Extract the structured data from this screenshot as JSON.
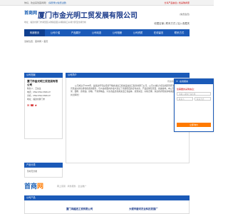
{
  "topbar": {
    "welcome": "你好，欢迎来到首商网！",
    "login": "[请登录]",
    "register": "[免费注册]",
    "right": "分享产品信息 | 找采购商家"
  },
  "header": {
    "logo": "首商网",
    "company": "厦门市金光明工贸发展有限公司",
    "address": "地址：福建省厦门市湖里区兴隆路园区兴湖路路口兴湖大厦宝龙湖景城",
    "member": "[免费会员]",
    "links": "收藏店铺 | 联系方式 | 加入收藏夹"
  },
  "nav": {
    "items": [
      "商铺首页",
      "公司介绍",
      "产品展厅",
      "公司动态",
      "公司相册",
      "公司资质",
      "在线留言",
      "联系方式"
    ]
  },
  "breadcrumb": "当前位置：首商网 > 首页",
  "sidebar": {
    "contact_head": "公司档案",
    "company": "厦门市金光明工贸发展有限公司",
    "contact_person": "联系人：王先生",
    "phone": "电话：0592-5532-5595-97",
    "mobile": "手机：0592-5532-5595-97",
    "address": "地址：福建省厦门市",
    "icons": "✉ ☎ ★",
    "category_head": "产品分类",
    "category_item": "暂时无分类"
  },
  "intro": {
    "head": "公司简介",
    "sub": "所属地区:福建厦门市",
    "text": "公司成立于1994年，是集多年专业经营干粮食进出口和食品进出口贸易的厦门公司，公司以诚信为宗旨和原则开发项目品牌。凭借良好的信誉和优质的服务，与众多的国内外客户建立了长期稳定的合作关系，产品远销东南亚、欧美等地。本公司主营各类大米、面粉、食用油、杂粮、干货调味品、冷冻食品及各类进出口食品等，货源充足，价格合理，欢迎各界朋友来电来函洽谈业务，共创辉煌！"
  },
  "banner": {
    "brand_a": "首商",
    "brand_b": "网",
    "tags": "网上贸易 · 商务服务 · 企业推广"
  },
  "bottom": {
    "head": "公司产品",
    "item1": "厦门鸿越洁工贸有限公司",
    "item2": "大理市碧河农业科技发展厂"
  },
  "float_panel": {
    "title": "在线留言",
    "close": "✕",
    "label": "您需要的采购信息：",
    "placeholder1": "请输入采购产品名称",
    "placeholder2": "联系人",
    "placeholder3": "联系方式",
    "submit": "立即询价"
  },
  "colors": {
    "primary": "#1b5ab8",
    "accent": "#ff7a00",
    "title": "#1a3a8a"
  }
}
